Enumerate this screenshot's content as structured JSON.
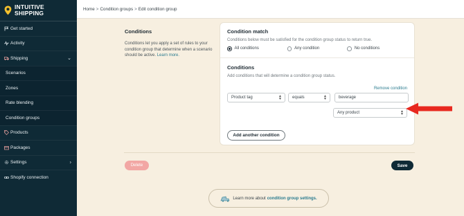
{
  "app": {
    "name_line1": "INTUITIVE",
    "name_line2": "SHIPPING"
  },
  "sidebar": {
    "items": [
      {
        "label": "Get started",
        "icon": "flag-icon"
      },
      {
        "label": "Activity",
        "icon": "pulse-icon"
      },
      {
        "label": "Shipping",
        "icon": "truck-icon",
        "expanded": true
      },
      {
        "label": "Scenarios",
        "sub": true
      },
      {
        "label": "Zones",
        "sub": true
      },
      {
        "label": "Rate blending",
        "sub": true
      },
      {
        "label": "Condition groups",
        "sub": true,
        "active": true
      },
      {
        "label": "Products",
        "icon": "tag-icon"
      },
      {
        "label": "Packages",
        "icon": "package-icon"
      },
      {
        "label": "Settings",
        "icon": "gear-icon"
      },
      {
        "label": "Shopify connection",
        "icon": "link-icon"
      }
    ]
  },
  "breadcrumb": [
    "Home",
    "Condition groups",
    "Edit condition group"
  ],
  "breadcrumb_sep": ">",
  "intro": {
    "title": "Conditions",
    "text": "Conditions let you apply a set of rules to your condition group that determine when a scenario should be active.",
    "link": "Learn more."
  },
  "condition_match": {
    "title": "Condition match",
    "description": "Conditions below must be satisfied for the condition group status to return true.",
    "options": [
      "All conditions",
      "Any condition",
      "No conditions"
    ],
    "selected": "All conditions"
  },
  "conditions": {
    "title": "Conditions",
    "description": "Add conditions that will determine a condition group status.",
    "remove_label": "Remove condition",
    "field_select": "Product tag",
    "operator_select": "equals",
    "value_input": "beverage",
    "scope_select": "Any product",
    "add_button": "Add another condition"
  },
  "actions": {
    "delete": "Delete",
    "save": "Save"
  },
  "learn_more": {
    "prefix": "Learn more about",
    "link": "condition group settings."
  },
  "colors": {
    "sidebar": "#0f2a36",
    "accent": "#2a7b8f",
    "arrow": "#e8281f",
    "delete": "#f2a7a4",
    "background": "#f7efe0"
  }
}
